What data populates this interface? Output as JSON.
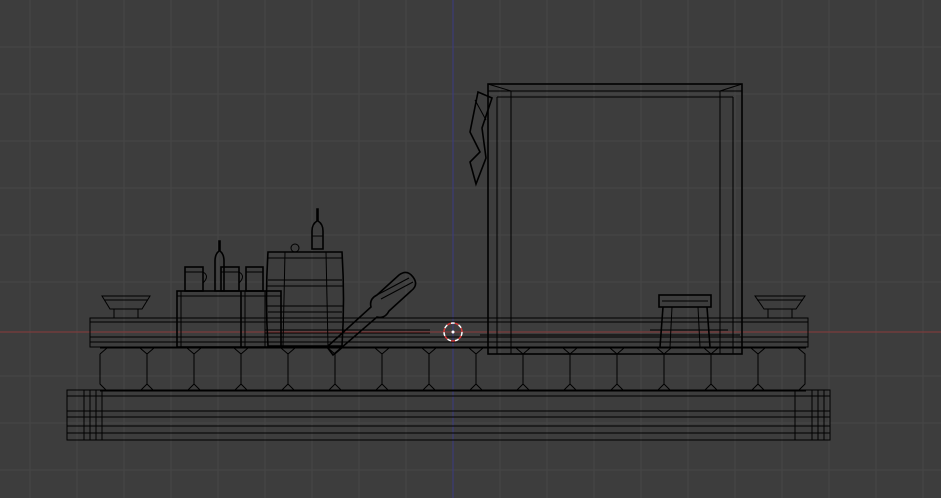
{
  "viewport": {
    "view": "front-orthographic",
    "shading": "wireframe",
    "background_color": "#3d3d3d",
    "grid_color": "#464646",
    "wire_color": "#000000",
    "x_axis_color": "#8a3a3a",
    "z_axis_color": "#3b3b84",
    "cursor_colors": [
      "#d23a3a",
      "#ffffff"
    ],
    "grid_visible": true
  },
  "scene": {
    "objects": [
      "table",
      "chalkboard-frame",
      "barrel",
      "crate",
      "mugs",
      "bottles",
      "guitar",
      "stool",
      "bowl-left",
      "bowl-right",
      "rug",
      "floor-tiles"
    ]
  }
}
